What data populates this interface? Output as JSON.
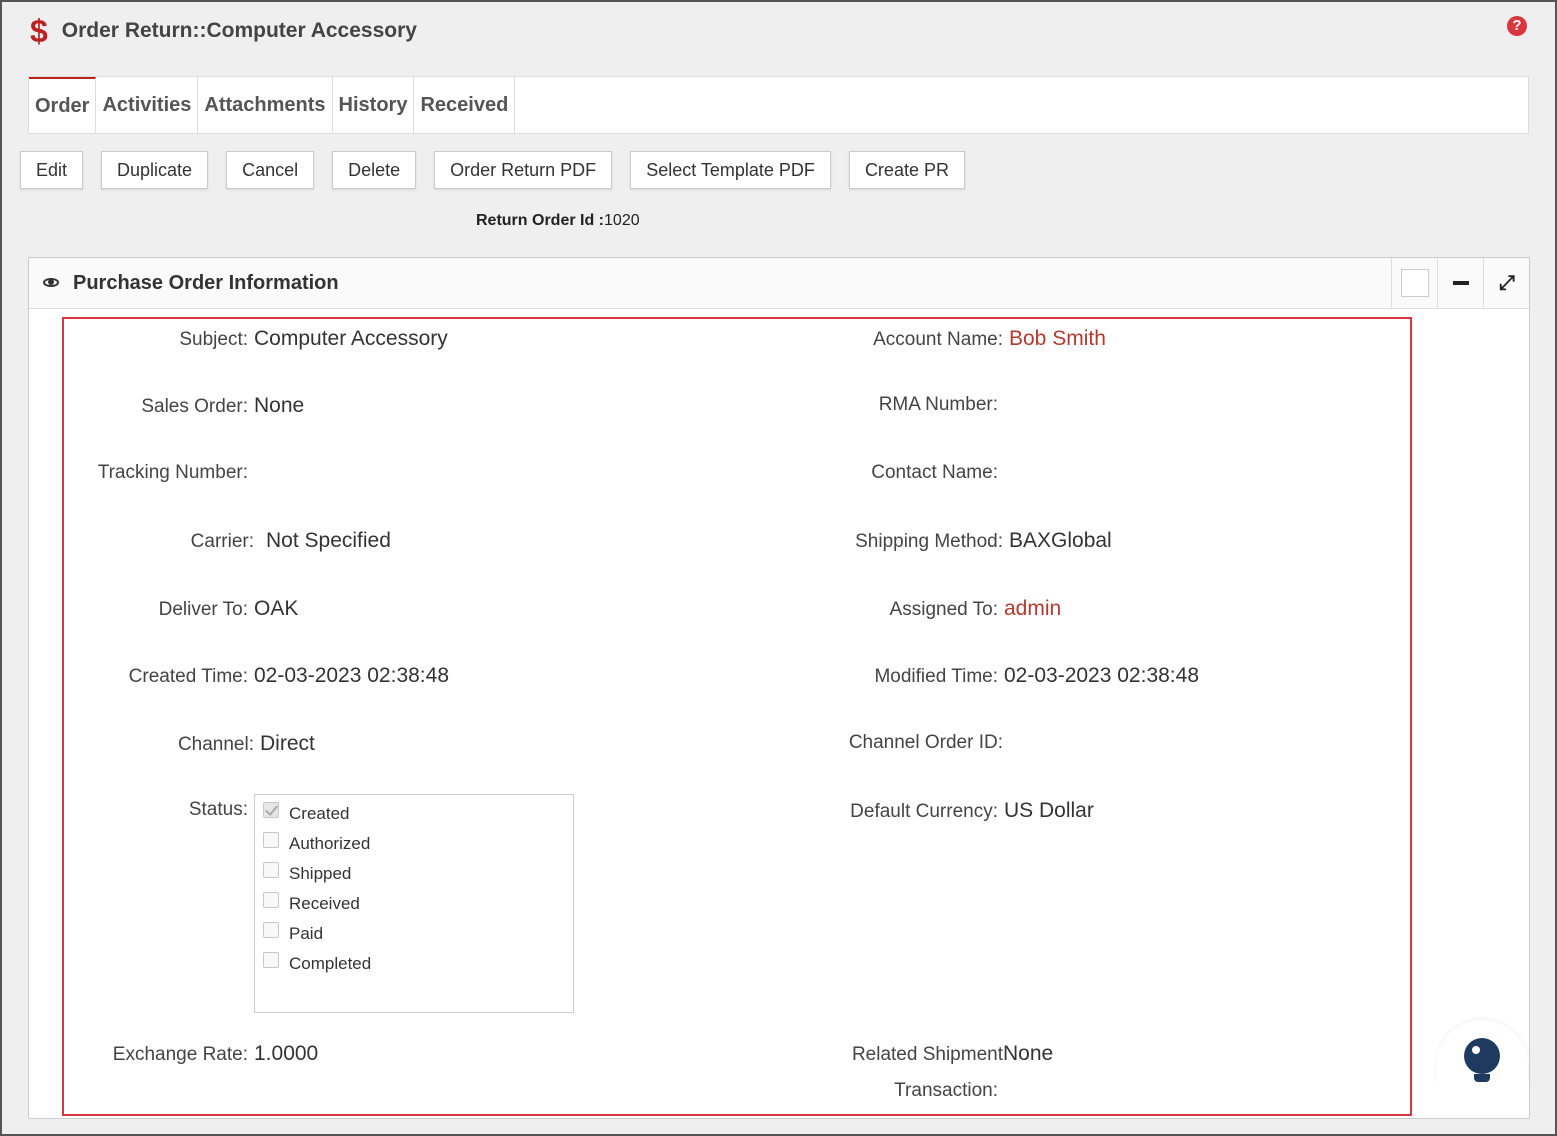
{
  "header": {
    "title": "Order Return::Computer Accessory",
    "icon": "dollar-icon",
    "help_glyph": "?"
  },
  "tabs": [
    {
      "label": "Order",
      "active": true
    },
    {
      "label": "Activities"
    },
    {
      "label": "Attachments"
    },
    {
      "label": "History"
    },
    {
      "label": "Received"
    }
  ],
  "toolbar": {
    "edit": "Edit",
    "duplicate": "Duplicate",
    "cancel": "Cancel",
    "delete": "Delete",
    "order_return_pdf": "Order Return PDF",
    "select_template_pdf": "Select Template PDF",
    "create_pr": "Create PR"
  },
  "return_order": {
    "label": "Return Order Id :",
    "value": "1020"
  },
  "panel": {
    "title": "Purchase Order Information",
    "collapse_glyph": "",
    "expand_glyph": "⤢"
  },
  "fields": {
    "subject": {
      "label": "Subject:",
      "value": "Computer Accessory"
    },
    "account_name": {
      "label": "Account Name:",
      "value": "Bob Smith"
    },
    "sales_order": {
      "label": "Sales Order:",
      "value": "None"
    },
    "rma_number": {
      "label": "RMA Number:",
      "value": ""
    },
    "tracking_number": {
      "label": "Tracking Number:",
      "value": ""
    },
    "contact_name": {
      "label": "Contact Name:",
      "value": ""
    },
    "carrier": {
      "label": "Carrier:",
      "value": "Not Specified"
    },
    "shipping_method": {
      "label": "Shipping Method:",
      "value": "BAXGlobal"
    },
    "deliver_to": {
      "label": "Deliver To:",
      "value": "OAK"
    },
    "assigned_to": {
      "label": "Assigned To:",
      "value": "admin"
    },
    "created_time": {
      "label": "Created Time:",
      "value": "02-03-2023 02:38:48"
    },
    "modified_time": {
      "label": "Modified Time:",
      "value": "02-03-2023 02:38:48"
    },
    "channel": {
      "label": "Channel:",
      "value": "Direct"
    },
    "channel_order_id": {
      "label": "Channel Order ID:",
      "value": ""
    },
    "status": {
      "label": "Status:"
    },
    "default_currency": {
      "label": "Default Currency:",
      "value": "US Dollar"
    },
    "exchange_rate": {
      "label": "Exchange Rate:",
      "value": "1.0000"
    },
    "related_shipment": {
      "label": "Related Shipment",
      "value": "None"
    },
    "transaction": {
      "label": "Transaction:",
      "value": ""
    }
  },
  "status_options": [
    {
      "label": "Created",
      "checked": true
    },
    {
      "label": "Authorized",
      "checked": false
    },
    {
      "label": "Shipped",
      "checked": false
    },
    {
      "label": "Received",
      "checked": false
    },
    {
      "label": "Paid",
      "checked": false
    },
    {
      "label": "Completed",
      "checked": false
    }
  ],
  "colors": {
    "accent": "#b22222",
    "link": "#b43a2e",
    "highlight_border": "#d9363e"
  }
}
